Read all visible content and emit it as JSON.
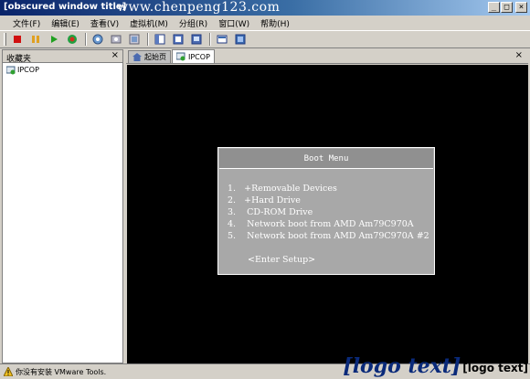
{
  "window": {
    "title": "[obscured window title]",
    "watermark": "www.chenpeng123.com"
  },
  "menu": [
    "文件(F)",
    "编辑(E)",
    "查看(V)",
    "虚拟机(M)",
    "分组(R)",
    "窗口(W)",
    "帮助(H)"
  ],
  "toolbar": {
    "icons": [
      "stop-icon",
      "pause-icon",
      "play-icon",
      "reset-icon",
      "snapshot-icon",
      "revert-snapshot-icon",
      "snapshot-manager-icon",
      "sidebar-view-icon",
      "summary-view-icon",
      "console-view-icon",
      "quick-switch-icon",
      "full-screen-icon"
    ]
  },
  "favorites": {
    "title": "收藏夹",
    "items": [
      "IPCOP"
    ]
  },
  "tabs": [
    "起始页",
    "IPCOP"
  ],
  "boot_menu": {
    "title": "Boot Menu",
    "items": [
      "1.   +Removable Devices",
      "2.   +Hard Drive",
      "3.    CD-ROM Drive",
      "4.    Network boot from AMD Am79C970A",
      "5.    Network boot from AMD Am79C970A #2"
    ],
    "footer": "<Enter Setup>"
  },
  "status": {
    "text": "你没有安装 VMware Tools."
  },
  "logo": {
    "brand": "[logo text]",
    "chinese": "[logo text]"
  },
  "colors": {
    "title_bar": "#0a246a",
    "chrome": "#d4d0c8",
    "console_bg": "#000000",
    "boot_menu_bg": "#a8a8a8"
  }
}
